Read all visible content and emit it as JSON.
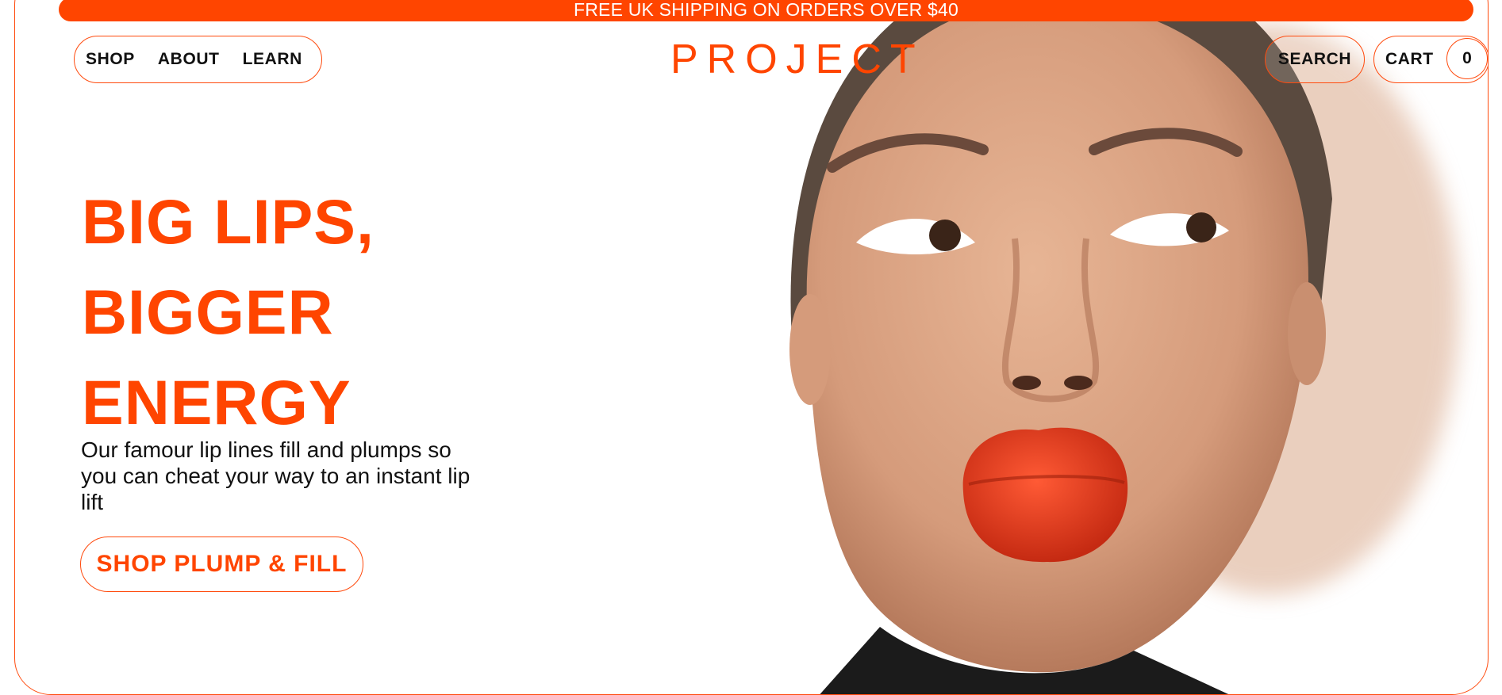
{
  "banner": {
    "text": "FREE UK SHIPPING ON ORDERS OVER $40"
  },
  "nav": {
    "items": [
      {
        "label": "SHOP"
      },
      {
        "label": "ABOUT"
      },
      {
        "label": "LEARN"
      }
    ]
  },
  "logo": {
    "text": "PROJECT"
  },
  "header_actions": {
    "search_label": "SEARCH",
    "cart_label": "CART",
    "cart_count": "0"
  },
  "hero": {
    "headline_lines": [
      "BIG LIPS,",
      "BIGGER",
      "ENERGY"
    ],
    "subcopy": "Our famour lip lines fill and plumps so you can cheat your way to an instant lip lift",
    "cta_label": "SHOP PLUMP & FILL",
    "image": "woman-pouting-red-lips-photo"
  },
  "colors": {
    "accent": "#ff4500",
    "text": "#111111",
    "background": "#ffffff"
  }
}
